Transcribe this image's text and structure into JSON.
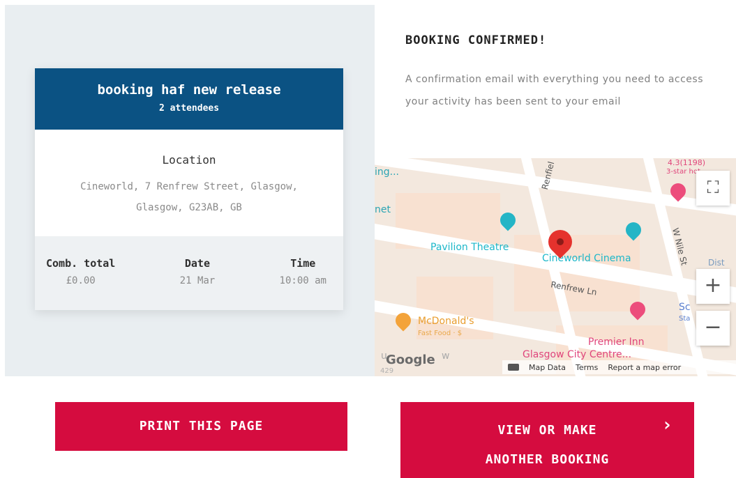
{
  "booking": {
    "title": "booking haf new release",
    "attendees": "2 attendees",
    "location_label": "Location",
    "location_line1": "Cineworld, 7 Renfrew Street, Glasgow,",
    "location_line2": "Glasgow, G23AB, GB",
    "details": [
      {
        "label": "Comb. total",
        "value": "£0.00"
      },
      {
        "label": "Date",
        "value": "21 Mar"
      },
      {
        "label": "Time",
        "value": "10:00 am"
      }
    ]
  },
  "confirmation": {
    "title": "BOOKING CONFIRMED!",
    "message": "A confirmation email with everything you need to access your activity has been sent to your email"
  },
  "map": {
    "labels": {
      "pavilion": "Pavilion Theatre",
      "cineworld": "Cineworld Cinema",
      "renfrew_ln": "Renfrew Ln",
      "renfield": "Renfiel",
      "nile": "W Nile St",
      "mcdonalds": "McDonald's",
      "mcdonalds_sub": "Fast Food · $",
      "premier": "Premier Inn",
      "premier_sub": "Glasgow City Centre...",
      "rating": "4.3(1198)",
      "rating_sub": "3-star hot",
      "edge_top": "ing...",
      "edge_net": "net",
      "edge_sc": "Sc",
      "edge_st": "Sta",
      "edge_dis": "Dist",
      "edge_w": "w",
      "edge_u": "u",
      "edge_129": "429"
    },
    "google": "Google",
    "footer": {
      "map_data": "Map Data",
      "terms": "Terms",
      "report": "Report a map error"
    },
    "controls": {
      "fullscreen": "⛶",
      "zoom_in": "+",
      "zoom_out": "−"
    }
  },
  "buttons": {
    "print": "PRINT THIS PAGE",
    "view_line1": "VIEW OR MAKE",
    "view_line2": "ANOTHER BOOKING",
    "chevron": "›"
  },
  "colors": {
    "header_blue": "#0b5283",
    "button_red": "#d50c3f",
    "marker_red": "#e5322d"
  }
}
